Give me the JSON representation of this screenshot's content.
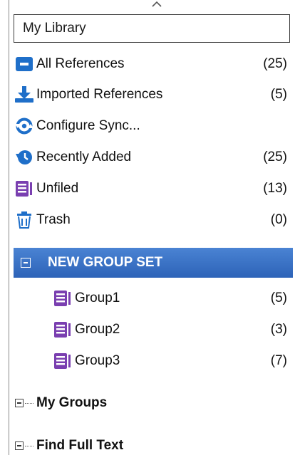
{
  "header": {
    "title": "My Library"
  },
  "library_items": [
    {
      "icon": "all-references-icon",
      "label": "All References",
      "count": "(25)"
    },
    {
      "icon": "imported-references-icon",
      "label": "Imported References",
      "count": "(5)"
    },
    {
      "icon": "sync-icon",
      "label": "Configure Sync...",
      "count": ""
    },
    {
      "icon": "recently-added-icon",
      "label": "Recently Added",
      "count": "(25)"
    },
    {
      "icon": "unfiled-icon",
      "label": "Unfiled",
      "count": "(13)"
    },
    {
      "icon": "trash-icon",
      "label": "Trash",
      "count": "(0)"
    }
  ],
  "group_set": {
    "label": "NEW GROUP SET",
    "groups": [
      {
        "icon": "group-icon",
        "label": "Group1",
        "count": "(5)"
      },
      {
        "icon": "group-icon",
        "label": "Group2",
        "count": "(3)"
      },
      {
        "icon": "group-icon",
        "label": "Group3",
        "count": "(7)"
      }
    ]
  },
  "sections": [
    {
      "label": "My Groups"
    },
    {
      "label": "Find Full Text"
    }
  ],
  "colors": {
    "accent_blue": "#2b6cc4",
    "group_purple": "#7a3fb0",
    "selection": "#3a73c9"
  }
}
